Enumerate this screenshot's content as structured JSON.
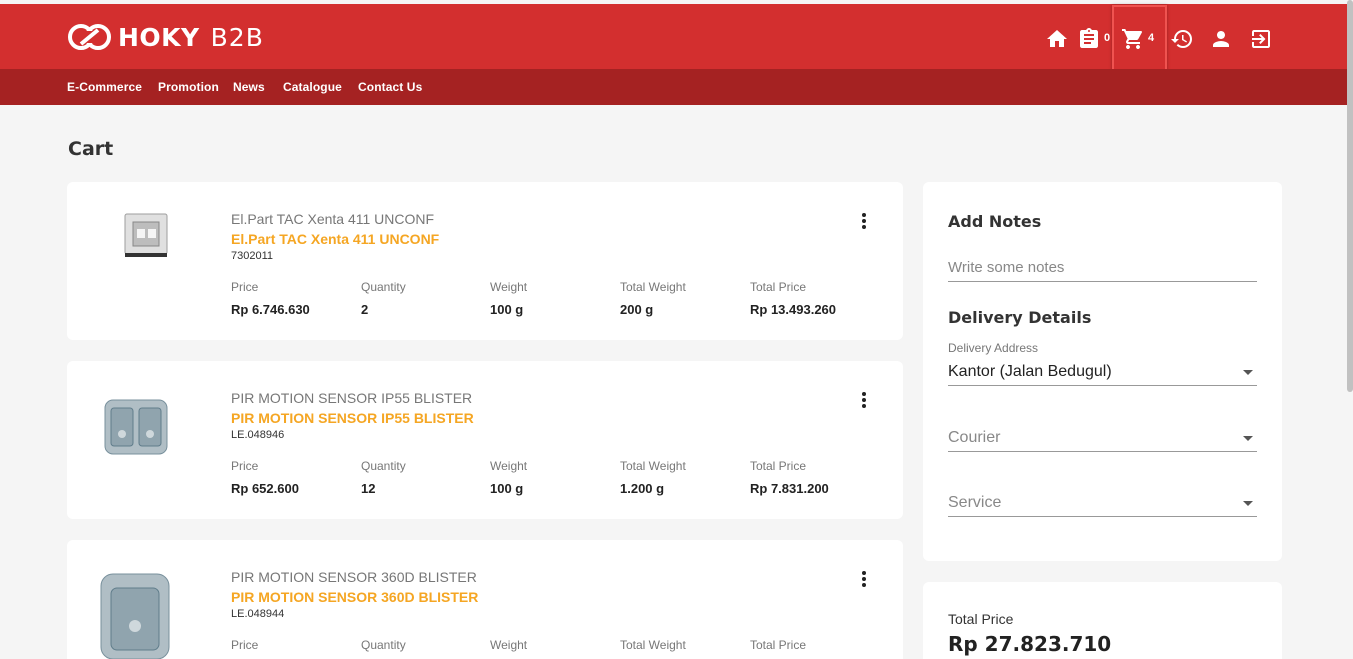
{
  "brand": {
    "name": "HOKY",
    "sub": "B2B"
  },
  "header": {
    "orders_badge": "0",
    "cart_badge": "4",
    "icons": [
      "home-icon",
      "clipboard-icon",
      "cart-icon",
      "history-icon",
      "user-icon",
      "logout-icon"
    ]
  },
  "nav": [
    "E-Commerce",
    "Promotion",
    "News",
    "Catalogue",
    "Contact Us"
  ],
  "page_title": "Cart",
  "labels": {
    "price": "Price",
    "quantity": "Quantity",
    "weight": "Weight",
    "total_weight": "Total Weight",
    "total_price": "Total Price"
  },
  "items": [
    {
      "name": "El.Part TAC Xenta 411 UNCONF",
      "title": "El.Part TAC Xenta 411 UNCONF",
      "code": "7302011",
      "price": "Rp 6.746.630",
      "quantity": "2",
      "weight": "100 g",
      "total_weight": "200 g",
      "total_price": "Rp 13.493.260"
    },
    {
      "name": "PIR MOTION SENSOR IP55 BLISTER",
      "title": "PIR MOTION SENSOR IP55 BLISTER",
      "code": "LE.048946",
      "price": "Rp 652.600",
      "quantity": "12",
      "weight": "100 g",
      "total_weight": "1.200 g",
      "total_price": "Rp 7.831.200"
    },
    {
      "name": "PIR MOTION SENSOR 360D BLISTER",
      "title": "PIR MOTION SENSOR 360D BLISTER",
      "code": "LE.048944",
      "price": "",
      "quantity": "",
      "weight": "",
      "total_weight": "",
      "total_price": ""
    }
  ],
  "sidebar": {
    "notes_heading": "Add Notes",
    "notes_placeholder": "Write some notes",
    "delivery_heading": "Delivery Details",
    "address_label": "Delivery Address",
    "address_value": "Kantor (Jalan Bedugul)",
    "courier_placeholder": "Courier",
    "service_placeholder": "Service"
  },
  "summary": {
    "total_label": "Total Price",
    "total_value": "Rp 27.823.710"
  },
  "colors": {
    "primary": "#d32f2f",
    "nav": "#a52222",
    "accent": "#f5a623"
  }
}
